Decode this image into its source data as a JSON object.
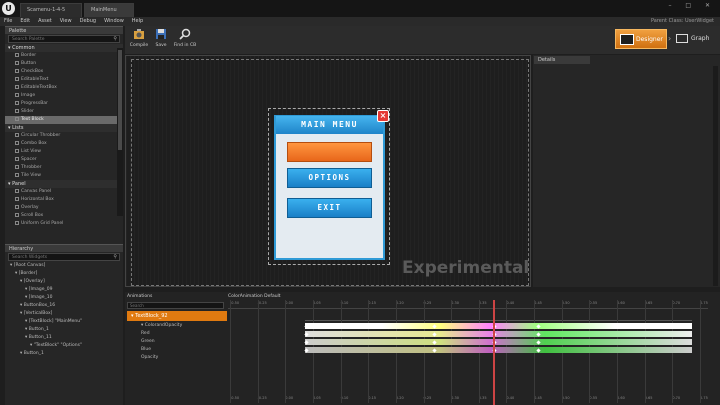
{
  "titlebar": {
    "tabs": [
      "Scamenu-1-4-5",
      "MainMenu"
    ],
    "controls": "– □ ✕"
  },
  "menubar": {
    "items": [
      "File",
      "Edit",
      "Asset",
      "View",
      "Debug",
      "Window",
      "Help"
    ],
    "parent_class": "Parent Class: UserWidget"
  },
  "palette": {
    "tab": "Palette",
    "search_placeholder": "Search Palette",
    "categories": [
      {
        "label": "Common",
        "items": [
          "Border",
          "Button",
          "CheckBox",
          "EditableText",
          "EditableTextBox",
          "Image",
          "ProgressBar",
          "Slider",
          "Text Block"
        ]
      },
      {
        "label": "Lists",
        "items": [
          "Circular Throbber",
          "Combo Box",
          "List View",
          "Spacer",
          "Throbber",
          "Tile View"
        ]
      },
      {
        "label": "Panel",
        "items": [
          "Canvas Panel",
          "Horizontal Box",
          "Overlay",
          "Scroll Box",
          "Uniform Grid Panel"
        ]
      }
    ],
    "selected_item": "Text Block"
  },
  "hierarchy": {
    "tab": "Hierarchy",
    "search_placeholder": "Search Widgets",
    "rows": [
      {
        "indent": 1,
        "text": "[Root Canvas]"
      },
      {
        "indent": 2,
        "text": "[Border]"
      },
      {
        "indent": 3,
        "text": "[Overlay]"
      },
      {
        "indent": 4,
        "text": "[Image_09"
      },
      {
        "indent": 4,
        "text": "[Image_10"
      },
      {
        "indent": 3,
        "text": "ButtonBox_16"
      },
      {
        "indent": 3,
        "text": "[VerticalBox]"
      },
      {
        "indent": 4,
        "text": "[TextBlock] \"MainMenu\""
      },
      {
        "indent": 4,
        "text": "Button_1"
      },
      {
        "indent": 4,
        "text": "Button_11"
      },
      {
        "indent": 5,
        "text": "\"TextBlock\" \"Options\""
      },
      {
        "indent": 3,
        "text": "Button_1"
      }
    ]
  },
  "toolbar": {
    "compile": "Compile",
    "save": "Save",
    "find": "Find in CB",
    "designer": "Designer",
    "graph": "Graph"
  },
  "designer": {
    "watermark": "Experimental"
  },
  "menu_widget": {
    "title": "MAIN MENU",
    "close": "×",
    "buttons": [
      "",
      "OPTIONS",
      "EXIT"
    ]
  },
  "details": {
    "tab": "Details"
  },
  "timeline": {
    "anim_header": "Animations",
    "anim_search_placeholder": "Search",
    "anim_name": "ColorAnimation Default",
    "selected_track": "TextBlock_92",
    "tracks": [
      "ColorandOpacity",
      "Red",
      "Green",
      "Blue",
      "Opacity"
    ],
    "ticks": [
      "-0.50",
      "-0.25",
      "0.00",
      "0.05",
      "0.10",
      "0.15",
      "0.20",
      "0.25",
      "0.30",
      "0.35",
      "0.40",
      "0.45",
      "0.50",
      "0.55",
      "0.60",
      "0.65",
      "0.70",
      "0.75"
    ]
  }
}
